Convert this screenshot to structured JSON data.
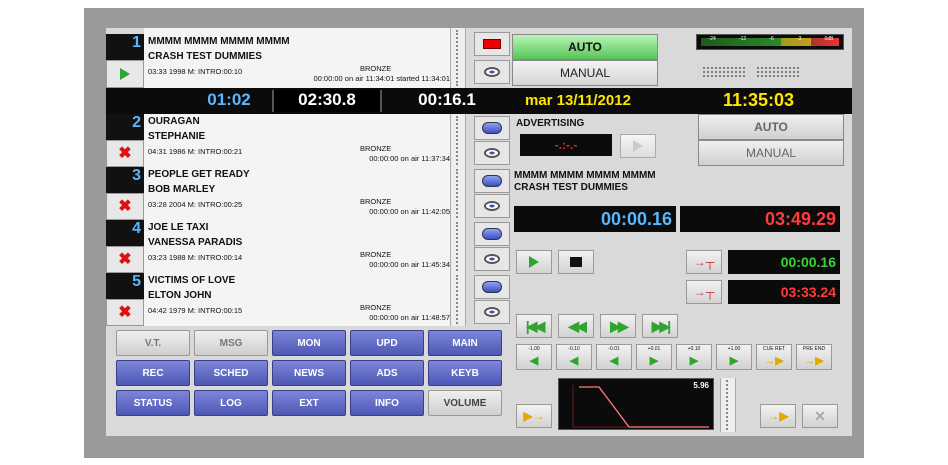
{
  "playlist": [
    {
      "number": "1",
      "title": "MMMM MMMM MMMM MMMM",
      "artist": "CRASH TEST DUMMIES",
      "info": "03:33 1998 M: INTRO:00:10",
      "category": "BRONZE",
      "onair": "00:00:00 on air 11:34:01 started 11:34:01",
      "action_icon": "play-icon"
    },
    {
      "number": "2",
      "title": "OURAGAN",
      "artist": "STEPHANIE",
      "info": "04:31 1986 M: INTRO:00:21",
      "category": "BRONZE",
      "onair": "00:00:00 on air 11:37:34",
      "action_icon": "delete-icon"
    },
    {
      "number": "3",
      "title": "PEOPLE GET READY",
      "artist": "BOB MARLEY",
      "info": "03:28 2004 M: INTRO:00:25",
      "category": "BRONZE",
      "onair": "00:00:00 on air 11:42:05",
      "action_icon": "delete-icon"
    },
    {
      "number": "4",
      "title": "JOE LE TAXI",
      "artist": "VANESSA PARADIS",
      "info": "03:23 1988 M: INTRO:00:14",
      "category": "BRONZE",
      "onair": "00:00:00 on air 11:45:34",
      "action_icon": "delete-icon"
    },
    {
      "number": "5",
      "title": "VICTIMS OF LOVE",
      "artist": "ELTON JOHN",
      "info": "04:42 1979 M: INTRO:00:15",
      "category": "BRONZE",
      "onair": "00:00:00 on air 11:48:57",
      "action_icon": "delete-icon"
    }
  ],
  "timers": {
    "t1": "01:02",
    "t2": "02:30.8",
    "t3": "00:16.1"
  },
  "clock": {
    "date": "mar 13/11/2012",
    "time": "11:35:03"
  },
  "mode": {
    "auto": "AUTO",
    "manual": "MANUAL"
  },
  "advertising": {
    "label": "ADVERTISING",
    "lcd": "-.:-.-",
    "auto": "AUTO",
    "manual": "MANUAL"
  },
  "vu_meter": {
    "scale": [
      "-24",
      "-12",
      "-6",
      "-3",
      "0dB"
    ]
  },
  "nowplaying": {
    "title": "MMMM MMMM MMMM MMMM",
    "artist": "CRASH TEST DUMMIES",
    "elapsed": "00:00.16",
    "remaining": "03:49.29",
    "intro_time": "00:00.16",
    "end_time": "03:33.24"
  },
  "cue_labels": [
    "-1.00",
    "-0.10",
    "-0.01",
    "+0.01",
    "+0.10",
    "+1.00",
    "CUE RET",
    "PRE END"
  ],
  "waveform": {
    "value": "5.96"
  },
  "function_buttons": [
    [
      "V.T.",
      "MSG",
      "MON",
      "UPD",
      "MAIN"
    ],
    [
      "REC",
      "SCHED",
      "NEWS",
      "ADS",
      "KEYB"
    ],
    [
      "STATUS",
      "LOG",
      "EXT",
      "INFO",
      "VOLUME"
    ]
  ],
  "colors": {
    "timer_blue": "#5ab7ff",
    "clock_yellow": "#ffe600",
    "time_red": "#ff3b3b",
    "time_green": "#38d438",
    "auto_green": "#7fe07f"
  }
}
